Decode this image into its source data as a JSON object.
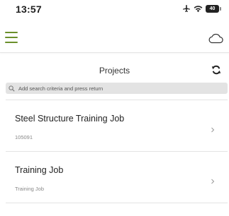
{
  "status_bar": {
    "time": "13:57",
    "battery_level": "40"
  },
  "nav": {
    "menu_icon": "hamburger-menu-icon",
    "cloud_icon": "cloud-icon",
    "accent_color": "#6b8f2b"
  },
  "header": {
    "title": "Projects",
    "refresh_icon": "refresh-icon"
  },
  "search": {
    "placeholder": "Add search criteria and press return",
    "value": ""
  },
  "projects": [
    {
      "title": "Steel Structure Training Job",
      "subtitle": "105091"
    },
    {
      "title": "Training Job",
      "subtitle": "Training Job"
    }
  ]
}
